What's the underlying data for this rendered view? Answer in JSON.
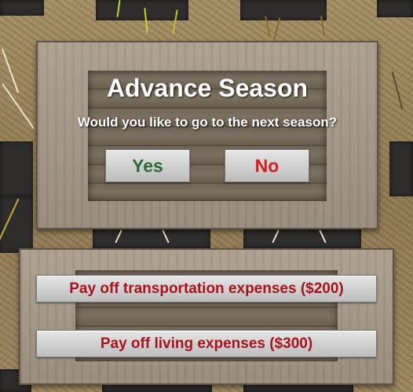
{
  "dialog": {
    "title": "Advance Season",
    "prompt": "Would you like to go to the next season?",
    "yes_label": "Yes",
    "no_label": "No"
  },
  "expenses": {
    "transportation_label": "Pay off transportation expenses ($200)",
    "living_label": "Pay off living expenses ($300)"
  },
  "colors": {
    "yes_text": "#2f6b3a",
    "no_text": "#d21f1f",
    "expense_text": "#a8141e"
  }
}
